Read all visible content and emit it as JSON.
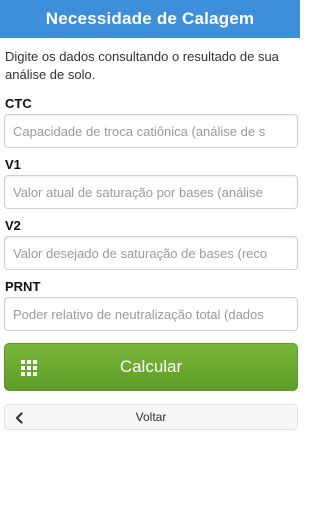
{
  "header": {
    "title": "Necessidade de Calagem"
  },
  "intro": "Digite os dados consultando o resultado de sua análise de solo.",
  "fields": [
    {
      "label": "CTC",
      "placeholder": "Capacidade de troca catiônica (análise de s"
    },
    {
      "label": "V1",
      "placeholder": "Valor atual de saturação por bases (análise"
    },
    {
      "label": "V2",
      "placeholder": "Valor desejado de saturação de bases (reco"
    },
    {
      "label": "PRNT",
      "placeholder": "Poder relativo de neutralização total (dados"
    }
  ],
  "calculate_button": {
    "label": "Calcular",
    "icon": "grid-icon"
  },
  "back_button": {
    "label": "Voltar",
    "icon": "chevron-left-icon"
  }
}
